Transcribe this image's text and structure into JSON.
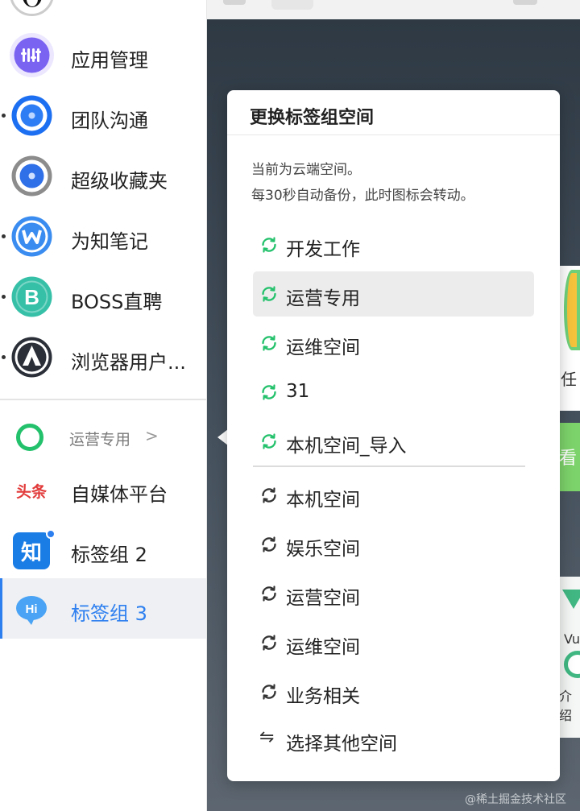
{
  "sidebar": {
    "apps": [
      {
        "label": "应用管理",
        "icon": "sliders-icon",
        "has_dot": false
      },
      {
        "label": "团队沟通",
        "icon": "chat-ring-icon",
        "has_dot": true
      },
      {
        "label": "超级收藏夹",
        "icon": "star-ring-icon",
        "has_dot": false
      },
      {
        "label": "为知笔记",
        "icon": "wiz-note-icon",
        "has_dot": true
      },
      {
        "label": "BOSS直聘",
        "icon": "boss-icon",
        "has_dot": true
      },
      {
        "label": "浏览器用户...",
        "icon": "browser-user-icon",
        "has_dot": true
      }
    ],
    "group": {
      "label": "运营专用",
      "chevron": ">"
    },
    "tab_items": [
      {
        "label": "自媒体平台",
        "icon": "toutiao-icon",
        "icon_text": "头条",
        "active": false
      },
      {
        "label": "标签组 2",
        "icon": "zhihu-icon",
        "icon_text": "知",
        "active": false,
        "badge": true
      },
      {
        "label": "标签组 3",
        "icon": "hi-chat-icon",
        "icon_text": "Hi",
        "active": true
      }
    ]
  },
  "background": {
    "task_text": "任",
    "green_text": "看",
    "vue_text": "Vu",
    "card_text": "介绍",
    "watermark": "@稀土掘金技术社区"
  },
  "popup": {
    "title": "更换标签组空间",
    "desc_line1": "当前为云端空间。",
    "desc_line2": "每30秒自动备份，此时图标会转动。",
    "cloud_spaces": [
      {
        "label": "开发工作"
      },
      {
        "label": "运营专用",
        "selected": true
      },
      {
        "label": "运维空间"
      },
      {
        "label": "31"
      },
      {
        "label": "本机空间_导入"
      }
    ],
    "local_spaces": [
      {
        "label": "本机空间"
      },
      {
        "label": "娱乐空间"
      },
      {
        "label": "运营空间"
      },
      {
        "label": "运维空间"
      },
      {
        "label": "业务相关"
      }
    ],
    "other_label": "选择其他空间"
  },
  "colors": {
    "accent_blue": "#2d7ff0",
    "sync_green": "#23c16b",
    "sync_gray": "#333333"
  }
}
